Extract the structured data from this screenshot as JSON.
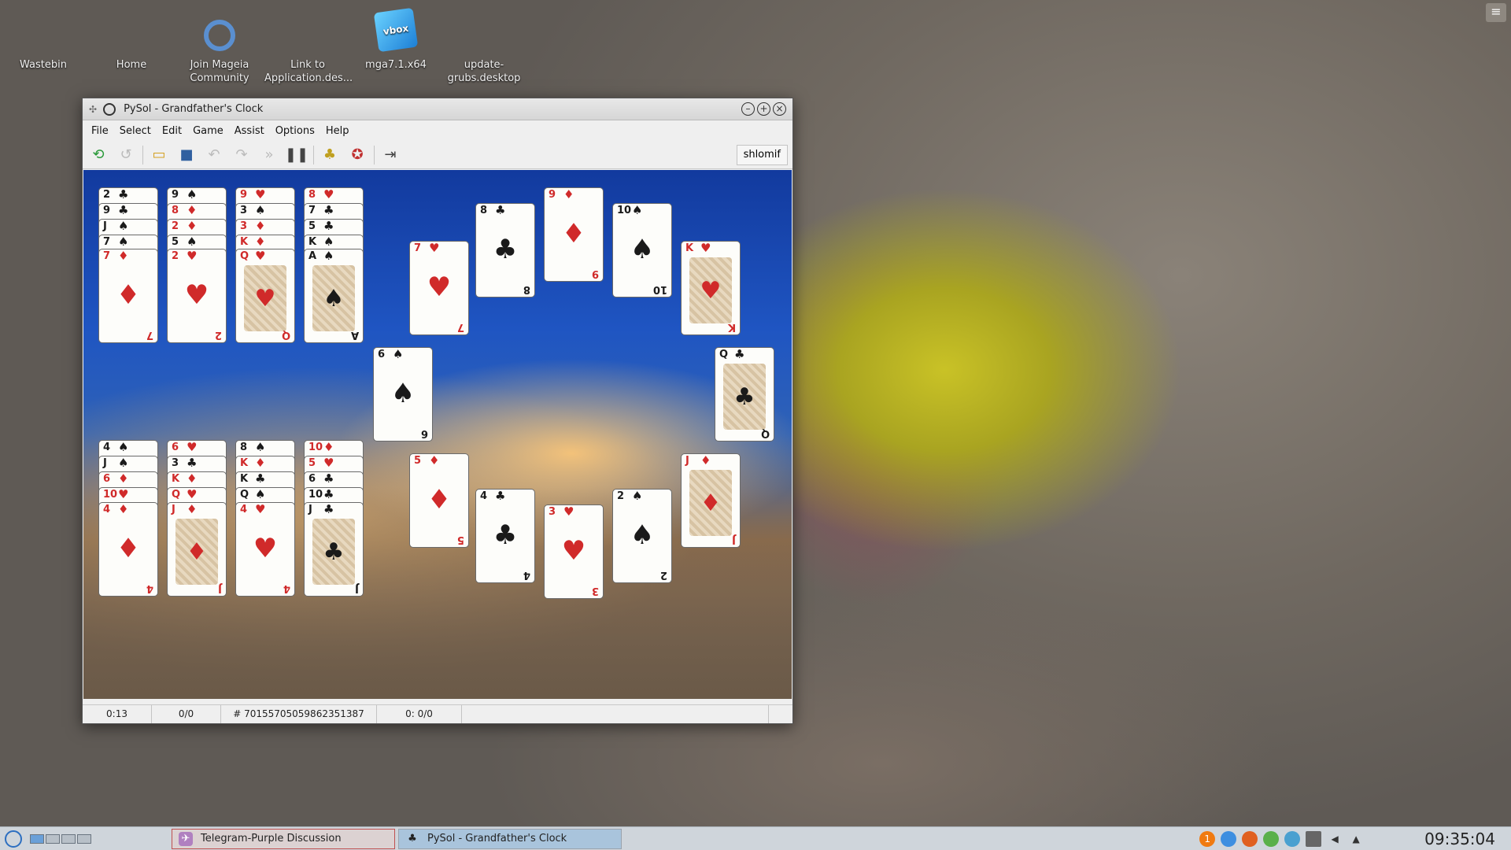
{
  "desktop": {
    "icons": [
      {
        "label": "Wastebin",
        "x": 0
      },
      {
        "label": "Home"
      },
      {
        "label": "Join Mageia Community"
      },
      {
        "label": "Link to Application.des..."
      },
      {
        "label": "mga7.1.x64"
      },
      {
        "label": "update-grubs.desktop"
      }
    ],
    "vbox_text": "vbox"
  },
  "window": {
    "title": "PySol - Grandfather's Clock",
    "menus": [
      "File",
      "Select",
      "Edit",
      "Game",
      "Assist",
      "Options",
      "Help"
    ],
    "player": "shlomif"
  },
  "cards": [
    {
      "rank": "7",
      "suit": "♦",
      "color": "red"
    },
    {
      "rank": "2",
      "suit": "♥",
      "color": "red"
    },
    {
      "rank": "Q",
      "suit": "♥",
      "color": "red",
      "face": true
    },
    {
      "rank": "A",
      "suit": "♠",
      "color": "black",
      "face": true
    },
    {
      "rank": "7",
      "suit": "♥",
      "color": "red"
    },
    {
      "rank": "8",
      "suit": "♣",
      "color": "black"
    },
    {
      "rank": "9",
      "suit": "♦",
      "color": "red"
    },
    {
      "rank": "10",
      "suit": "♠",
      "color": "black"
    },
    {
      "rank": "K",
      "suit": "♥",
      "color": "red",
      "face": true
    },
    {
      "rank": "6",
      "suit": "♠",
      "color": "black"
    },
    {
      "rank": "Q",
      "suit": "♣",
      "color": "black",
      "face": true
    },
    {
      "rank": "5",
      "suit": "♦",
      "color": "red"
    },
    {
      "rank": "4",
      "suit": "♣",
      "color": "black"
    },
    {
      "rank": "3",
      "suit": "♥",
      "color": "red"
    },
    {
      "rank": "2",
      "suit": "♠",
      "color": "black"
    },
    {
      "rank": "J",
      "suit": "♦",
      "color": "red",
      "face": true
    },
    {
      "rank": "4",
      "suit": "♦",
      "color": "red"
    },
    {
      "rank": "J",
      "suit": "♦",
      "color": "red",
      "face": true
    },
    {
      "rank": "4",
      "suit": "♥",
      "color": "red"
    },
    {
      "rank": "J",
      "suit": "♣",
      "color": "black",
      "face": true
    }
  ],
  "statusbar": {
    "time": "0:13",
    "moves": "0/0",
    "game_number": "# 70155705059862351387",
    "score": "0: 0/0"
  },
  "taskbar": {
    "tasks": [
      "Telegram-Purple Discussion",
      "PySol - Grandfather's Clock"
    ],
    "clock": "09:35:04",
    "tray_badge": "1"
  }
}
